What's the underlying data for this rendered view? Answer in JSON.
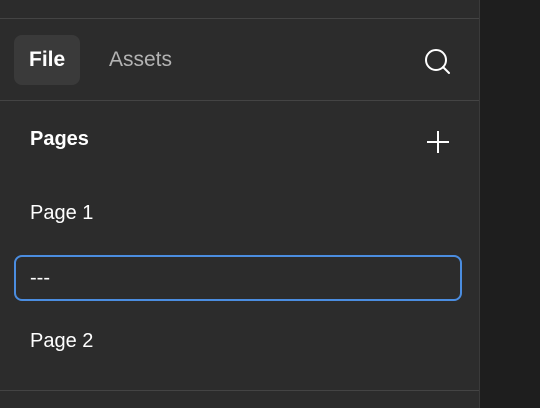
{
  "tabs": [
    {
      "label": "File",
      "active": true
    },
    {
      "label": "Assets",
      "active": false
    }
  ],
  "icons": {
    "search": "search-icon",
    "add": "plus-icon"
  },
  "pages": {
    "title": "Pages",
    "items": [
      {
        "label": "Page 1"
      },
      {
        "label": "---",
        "editing": true
      },
      {
        "label": "Page 2"
      }
    ]
  },
  "colors": {
    "panel_bg": "#2c2c2c",
    "focus_border": "#4b8de0",
    "inactive_text": "#b3b3b3"
  }
}
